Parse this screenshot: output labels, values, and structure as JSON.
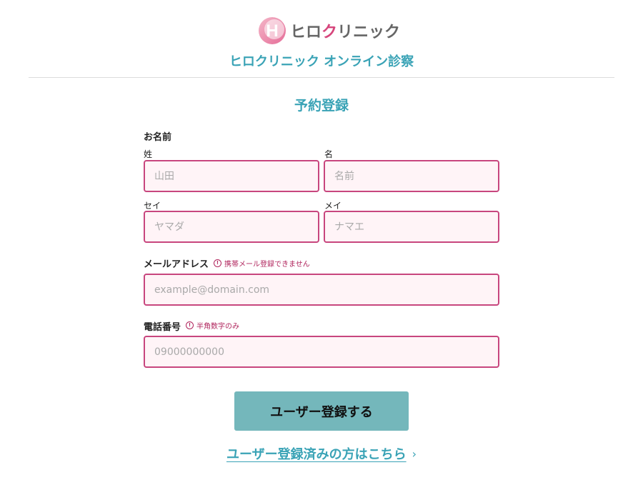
{
  "header": {
    "logo": {
      "text_prefix": "ヒロ",
      "text_accent": "ク",
      "text_suffix": "リニック"
    },
    "site_title": "ヒロクリニック オンライン診察"
  },
  "page_title": "予約登録",
  "form": {
    "name_label": "お名前",
    "last_name": {
      "label": "姓",
      "placeholder": "山田",
      "value": ""
    },
    "first_name": {
      "label": "名",
      "placeholder": "名前",
      "value": ""
    },
    "last_name_kana": {
      "label": "セイ",
      "placeholder": "ヤマダ",
      "value": ""
    },
    "first_name_kana": {
      "label": "メイ",
      "placeholder": "ナマエ",
      "value": ""
    },
    "email": {
      "label": "メールアドレス",
      "note": "携帯メール登録できません",
      "note_icon": "!",
      "placeholder": "example@domain.com",
      "value": ""
    },
    "phone": {
      "label": "電話番号",
      "note": "半角数字のみ",
      "note_icon": "!",
      "placeholder": "09000000000",
      "value": ""
    }
  },
  "submit_label": "ユーザー登録する",
  "login_link": {
    "label": "ユーザー登録済みの方はこちら",
    "chevron": "›"
  },
  "colors": {
    "accent_teal": "#3aa3b6",
    "button_teal": "#74b7bb",
    "field_border_pink": "#c8467e",
    "field_bg_pink": "#fff4f7",
    "note_red": "#b0245c",
    "logo_pink": "#d6457c"
  },
  "icons": {
    "logo_mark": "h-logo-icon",
    "note": "info-circle-icon",
    "link_arrow": "chevron-right-icon"
  }
}
